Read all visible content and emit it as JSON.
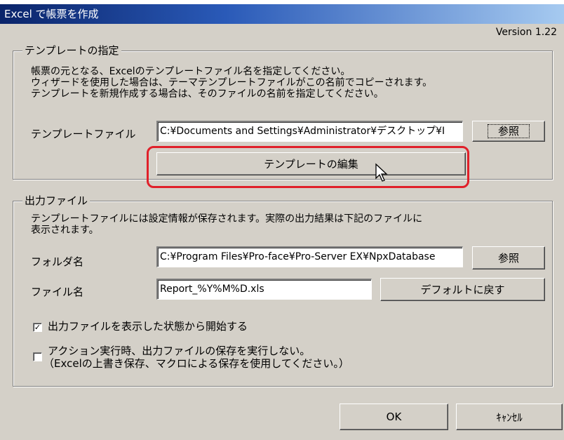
{
  "window": {
    "title": "Excel で帳票を作成",
    "version": "Version 1.22"
  },
  "template_group": {
    "legend": "テンプレートの指定",
    "description": [
      "帳票の元となる、Excelのテンプレートファイル名を指定してください。",
      "ウィザードを使用した場合は、テーマテンプレートファイルがこの名前でコピーされます。",
      "テンプレートを新規作成する場合は、そのファイルの名前を指定してください。"
    ],
    "file_label": "テンプレートファイル",
    "file_value": "C:¥Documents and Settings¥Administrator¥デスクトップ¥I",
    "browse_label": "参照",
    "edit_label": "テンプレートの編集"
  },
  "output_group": {
    "legend": "出力ファイル",
    "description": [
      "テンプレートファイルには設定情報が保存されます。実際の出力結果は下記のファイルに",
      "表示されます。"
    ],
    "folder_label": "フォルダ名",
    "folder_value": "C:¥Program Files¥Pro-face¥Pro-Server EX¥NpxDatabase",
    "folder_browse_label": "参照",
    "filename_label": "ファイル名",
    "filename_value": "Report_%Y%M%D.xls",
    "default_label": "デフォルトに戻す",
    "show_output": {
      "label": "出力ファイルを表示した状態から開始する",
      "checked": true,
      "mark": "✓"
    },
    "no_save": {
      "label_line1": "アクション実行時、出力ファイルの保存を実行しない。",
      "label_line2": "（Excelの上書き保存、マクロによる保存を使用してください。）",
      "checked": false
    }
  },
  "buttons": {
    "ok": "OK",
    "cancel": "ｷｬﾝｾﾙ"
  },
  "colors": {
    "highlight": "#e0202a",
    "title_bar": "#0a246a",
    "dialog_bg": "#d4d0c8"
  }
}
